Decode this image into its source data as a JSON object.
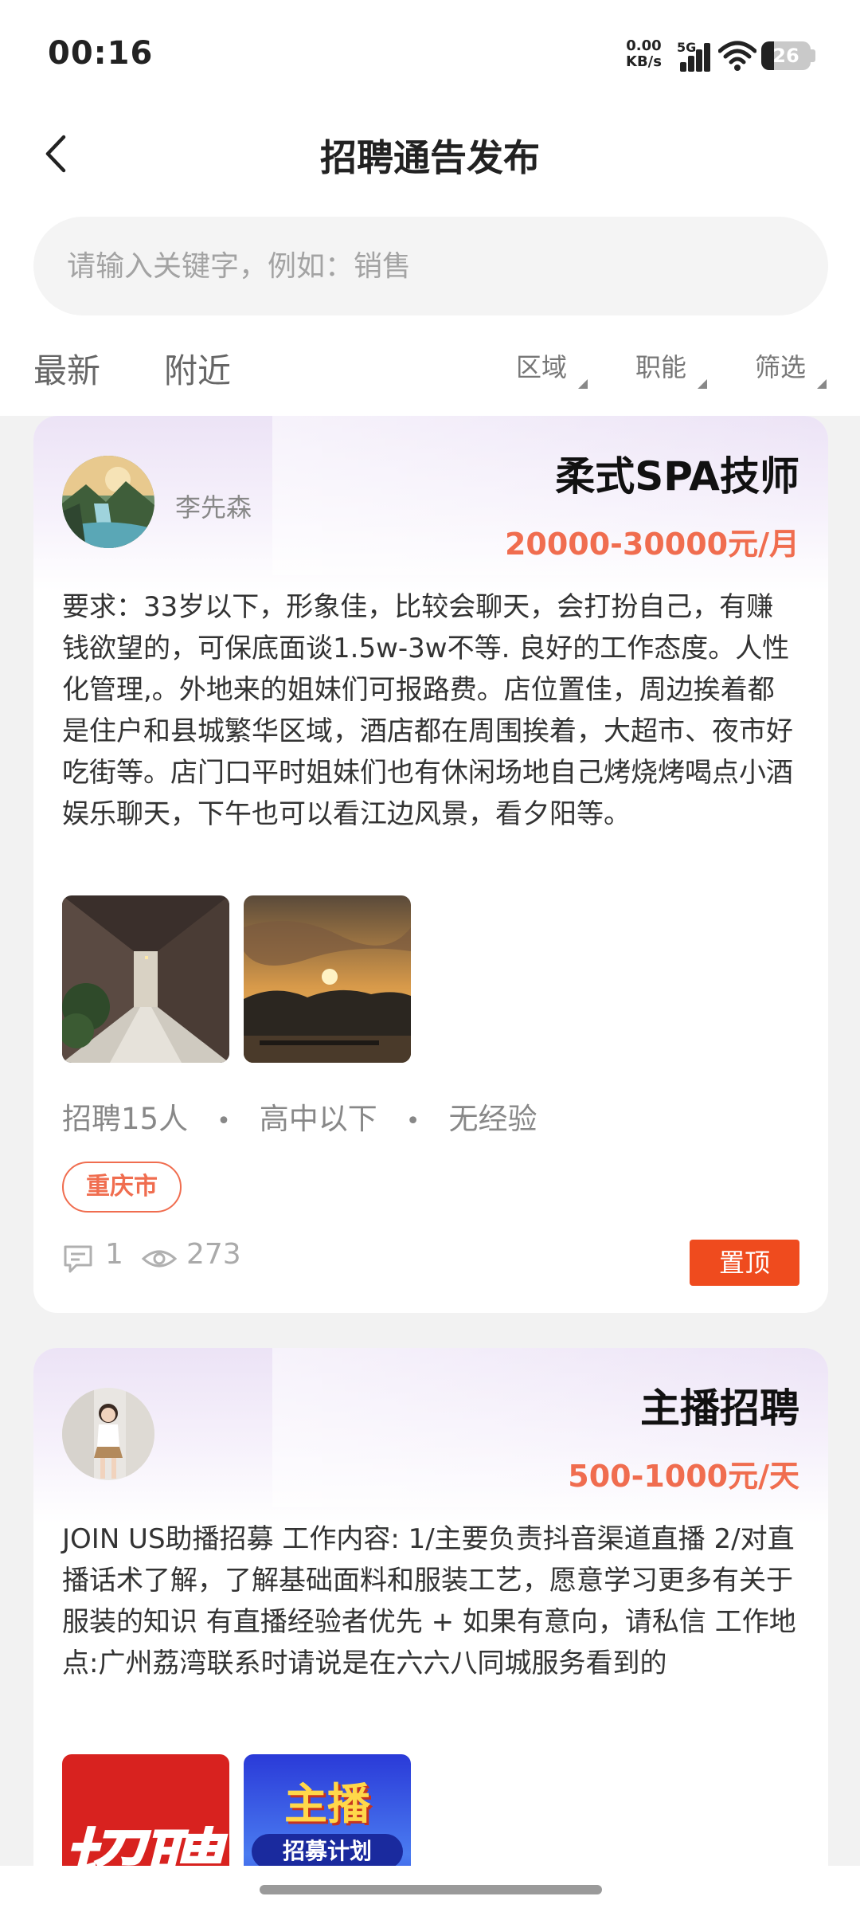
{
  "status_bar": {
    "time": "00:16",
    "net_speed_value": "0.00",
    "net_speed_unit": "KB/s",
    "network_type": "5G",
    "battery_level": "26"
  },
  "header": {
    "title": "招聘通告发布"
  },
  "search": {
    "placeholder": "请输入关键字，例如：销售"
  },
  "tabs": {
    "latest": "最新",
    "nearby": "附近"
  },
  "filters": {
    "region": "区域",
    "function": "职能",
    "filter": "筛选"
  },
  "posts": [
    {
      "poster_name": "李先森",
      "job_title": "柔式SPA技师",
      "salary": "20000-30000元/月",
      "description": "要求：33岁以下，形象佳，比较会聊天，会打扮自己，有赚钱欲望的，可保底面谈1.5w-3w不等. 良好的工作态度。人性化管理,。外地来的姐妹们可报路费。店位置佳，周边挨着都是住户和县城繁华区域，酒店都在周围挨着，大超市、夜市好吃街等。店门口平时姐妹们也有休闲场地自己烤烧烤喝点小酒娱乐聊天，下午也可以看江边风景，看夕阳等。",
      "headcount": "招聘15人",
      "education": "高中以下",
      "experience": "无经验",
      "city": "重庆市",
      "comments": "1",
      "views": "273",
      "pin_label": "置顶"
    },
    {
      "job_title": "主播招聘",
      "salary": "500-1000元/天",
      "description": "JOIN US助播招募 工作内容: 1/主要负责抖音渠道直播 2/对直播话术了解，了解基础面料和服装工艺，愿意学习更多有关于服装的知识 有直播经验者优先 + 如果有意向，请私信 工作地点:广州荔湾联系时请说是在六六八同城服务看到的",
      "photo1_text": "招聘",
      "photo2_text_top": "主播",
      "photo2_text_bottom": "招募计划"
    }
  ],
  "colors": {
    "accent": "#f06d4f",
    "pin_button": "#ef4b1e",
    "card_gradient": "#ece3f6"
  }
}
